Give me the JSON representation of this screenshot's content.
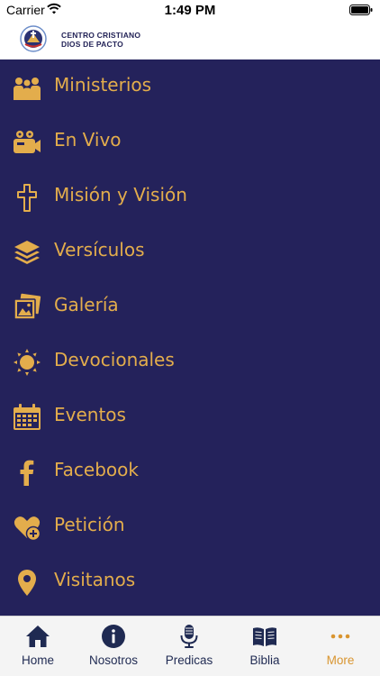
{
  "status_bar": {
    "carrier": "Carrier",
    "time": "1:49 PM"
  },
  "header": {
    "brand_line1": "CENTRO CRISTIANO",
    "brand_line2": "DIOS DE PACTO",
    "logo_icon": "church-seal-logo"
  },
  "colors": {
    "menu_background": "#24225b",
    "accent": "#e3ad4c",
    "tab_active": "#d99530",
    "tab_inactive": "#1f2a52"
  },
  "menu": {
    "items": [
      {
        "label": "Ministerios",
        "icon": "people-group-icon"
      },
      {
        "label": "En Vivo",
        "icon": "video-camera-icon"
      },
      {
        "label": "Misión y Visión",
        "icon": "cross-icon"
      },
      {
        "label": "Versículos",
        "icon": "layers-icon"
      },
      {
        "label": "Galería",
        "icon": "photo-gallery-icon"
      },
      {
        "label": "Devocionales",
        "icon": "sun-icon"
      },
      {
        "label": "Eventos",
        "icon": "calendar-icon"
      },
      {
        "label": "Facebook",
        "icon": "facebook-icon"
      },
      {
        "label": "Petición",
        "icon": "heart-plus-icon"
      },
      {
        "label": "Visitanos",
        "icon": "location-pin-icon"
      }
    ]
  },
  "tab_bar": {
    "tabs": [
      {
        "label": "Home",
        "icon": "home-icon"
      },
      {
        "label": "Nosotros",
        "icon": "info-icon"
      },
      {
        "label": "Predicas",
        "icon": "microphone-icon"
      },
      {
        "label": "Biblia",
        "icon": "book-icon"
      },
      {
        "label": "More",
        "icon": "more-dots-icon",
        "active": true
      }
    ]
  }
}
